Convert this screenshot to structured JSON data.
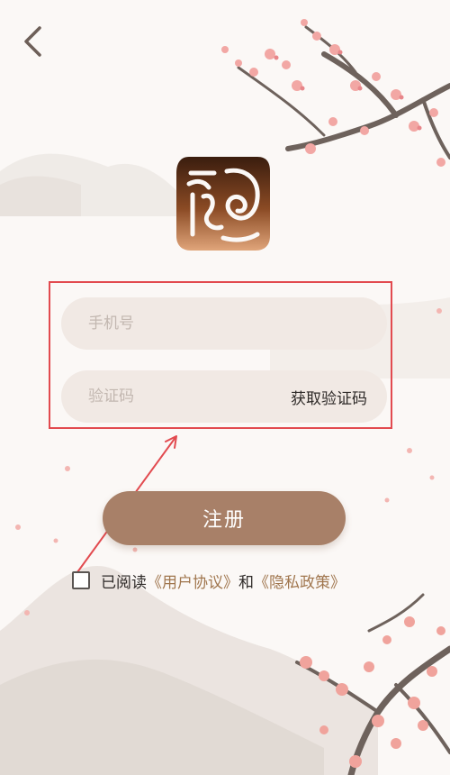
{
  "header": {
    "back_icon": "chevron-left-icon"
  },
  "logo": {
    "icon": "seal-logo-icon"
  },
  "form": {
    "phone_placeholder": "手机号",
    "code_placeholder": "验证码",
    "get_code_label": "获取验证码"
  },
  "register": {
    "label": "注册"
  },
  "agreement": {
    "prefix": "已阅读",
    "user_agreement": "《用户协议》",
    "and": "和",
    "privacy_policy": "《隐私政策》"
  },
  "colors": {
    "accent": "#a88068",
    "field_bg": "#f1e9e4",
    "link": "#a0764e",
    "highlight": "#e24a4f"
  }
}
